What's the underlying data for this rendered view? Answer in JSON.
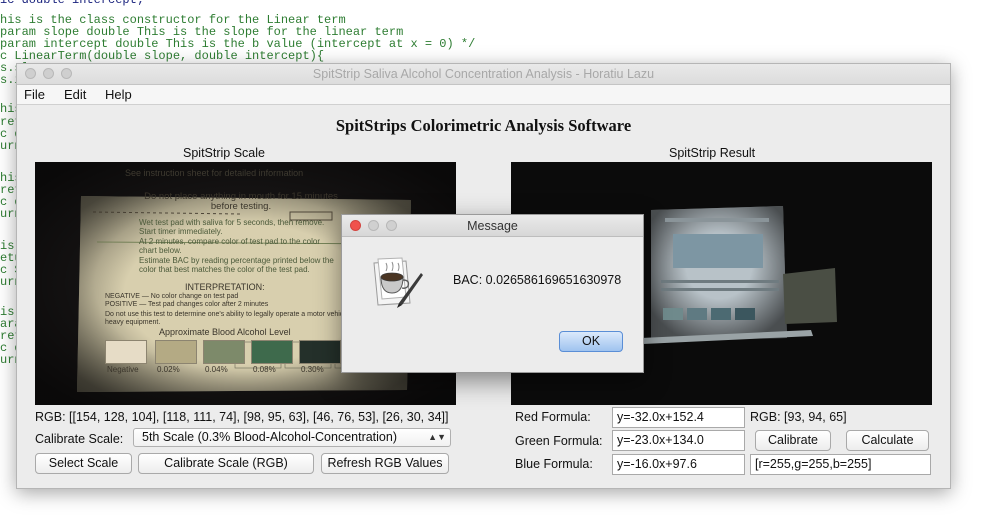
{
  "editor": {
    "lines": [
      "ic double intercept;",
      "his is the class constructor for the Linear term",
      "param slope double This is the slope for the linear term",
      "param intercept double This is the b value (intercept at x = 0) */",
      "c LinearTerm(double slope, double intercept){",
      "s.sl",
      "s.i",
      "his",
      "ret",
      "c d",
      "urn",
      "his",
      "ret",
      "c d",
      "urn",
      "is",
      "etu",
      "c S",
      "urn",
      "is",
      "ara",
      "ret",
      "c d",
      "urn"
    ]
  },
  "window": {
    "title": "SpitStrip Saliva Alcohol Concentration Analysis - Horatiu Lazu",
    "menu": [
      "File",
      "Edit",
      "Help"
    ],
    "heading": "SpitStrips Colorimetric Analysis Software",
    "scale_panel_label": "SpitStrip Scale",
    "result_panel_label": "SpitStrip Result",
    "rgb_text": "RGB: [[154, 128, 104], [118, 111, 74], [98, 95, 63], [46, 76, 53], [26, 30, 34]]",
    "calibrate_scale_label": "Calibrate Scale:",
    "calibrate_scale_value": "5th Scale (0.3% Blood-Alcohol-Concentration)",
    "select_scale_button": "Select Scale",
    "calibrate_rgb_button": "Calibrate Scale (RGB)",
    "refresh_button": "Refresh RGB Values",
    "red_formula_label": "Red Formula:",
    "red_formula_value": "y=-32.0x+152.4",
    "green_formula_label": "Green Formula:",
    "green_formula_value": "y=-23.0x+134.0",
    "blue_formula_label": "Blue Formula:",
    "blue_formula_value": "y=-16.0x+97.6",
    "result_rgb": "RGB: [93, 94, 65]",
    "calibrate_button": "Calibrate",
    "calculate_button": "Calculate",
    "rgb_field_value": "[r=255,g=255,b=255]"
  },
  "strip": {
    "header": "See instruction sheet for detailed information",
    "warning": "Do not place anything in mouth for 15 minutes before testing.",
    "steps": [
      "Wet test pad with saliva for 5 seconds, then remove. Start timer immediately.",
      "At 2 minutes, compare color of test pad to the color chart below.",
      "Estimate BAC by reading percentage printed below the color that best matches the color of the test pad."
    ],
    "interpretation": "INTERPRETATION:",
    "negative": "NEGATIVE — No color change on test pad",
    "positive": "POSITIVE — Test pad changes color after 2 minutes",
    "disclaimer": "Do not use this test to determine one's ability to legally operate a motor vehicle or other heavy equipment.",
    "chart_title": "Approximate Blood Alcohol Level",
    "chart_labels": [
      "Negative",
      "0.02%",
      "0.04%",
      "0.08%",
      "0.30%"
    ],
    "swatch_colors": [
      "#e6dcc6",
      "#b4aa84",
      "#7d8a6a",
      "#3e6a4c",
      "#24302a"
    ]
  },
  "dialog": {
    "title": "Message",
    "message": "BAC: 0.026586169651630978",
    "ok_button": "OK"
  }
}
